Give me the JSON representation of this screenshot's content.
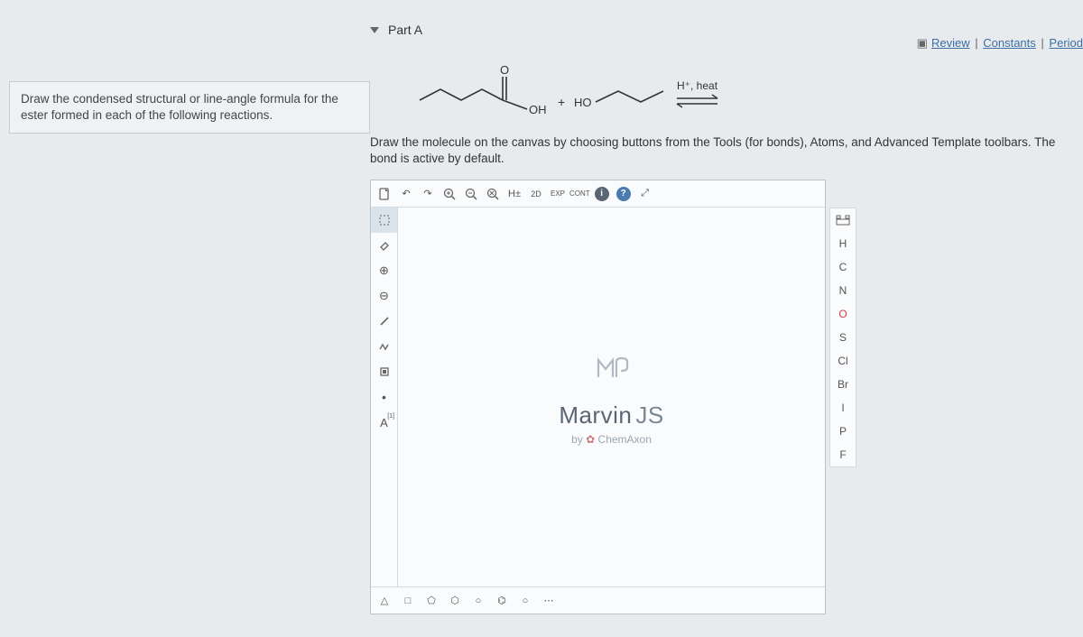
{
  "top_links": {
    "review": "Review",
    "constants": "Constants",
    "periodic": "Period"
  },
  "part": {
    "label": "Part A"
  },
  "left_instruction": "Draw the condensed structural or line-angle formula for the ester formed in each of the following reactions.",
  "reaction": {
    "oxygen": "O",
    "oh": "OH",
    "plus": "+",
    "ho": "HO",
    "condition": "H⁺, heat"
  },
  "draw_instruction": "Draw the molecule on the canvas by choosing buttons from the Tools (for bonds), Atoms, and Advanced Template toolbars. The bond is active by default.",
  "editor": {
    "top": {
      "new": "⬚",
      "undo": "↶",
      "redo": "↷",
      "zoomin": "⊕",
      "zoomout": "⊖",
      "zoomreset": "⊗",
      "hydrogen": "H±",
      "view2d": "2D",
      "exp": "EXP",
      "cont": "CONT",
      "info": "i",
      "help": "?",
      "full": "⤢"
    },
    "left": {
      "select": "⬚",
      "eraser": "⌫",
      "chargeplus": "⊕",
      "chargeminus": "⊖",
      "bond": "╱",
      "chain": "ᴧ",
      "template": "⬚",
      "radical": "•",
      "annotation": "A"
    },
    "right": {
      "periodic": "☷",
      "h": "H",
      "c": "C",
      "n": "N",
      "o": "O",
      "s": "S",
      "cl": "Cl",
      "br": "Br",
      "i": "I",
      "p": "P",
      "f": "F"
    },
    "bottom": {
      "tri": "△",
      "square": "□",
      "pent": "⬠",
      "hex": "⬡",
      "hept": "○",
      "benz": "⌬",
      "cyclo": "○",
      "custom": "⋯"
    },
    "brand": {
      "marvin": "Marvin",
      "js": "JS",
      "by": "by",
      "company": "ChemAxon"
    }
  }
}
